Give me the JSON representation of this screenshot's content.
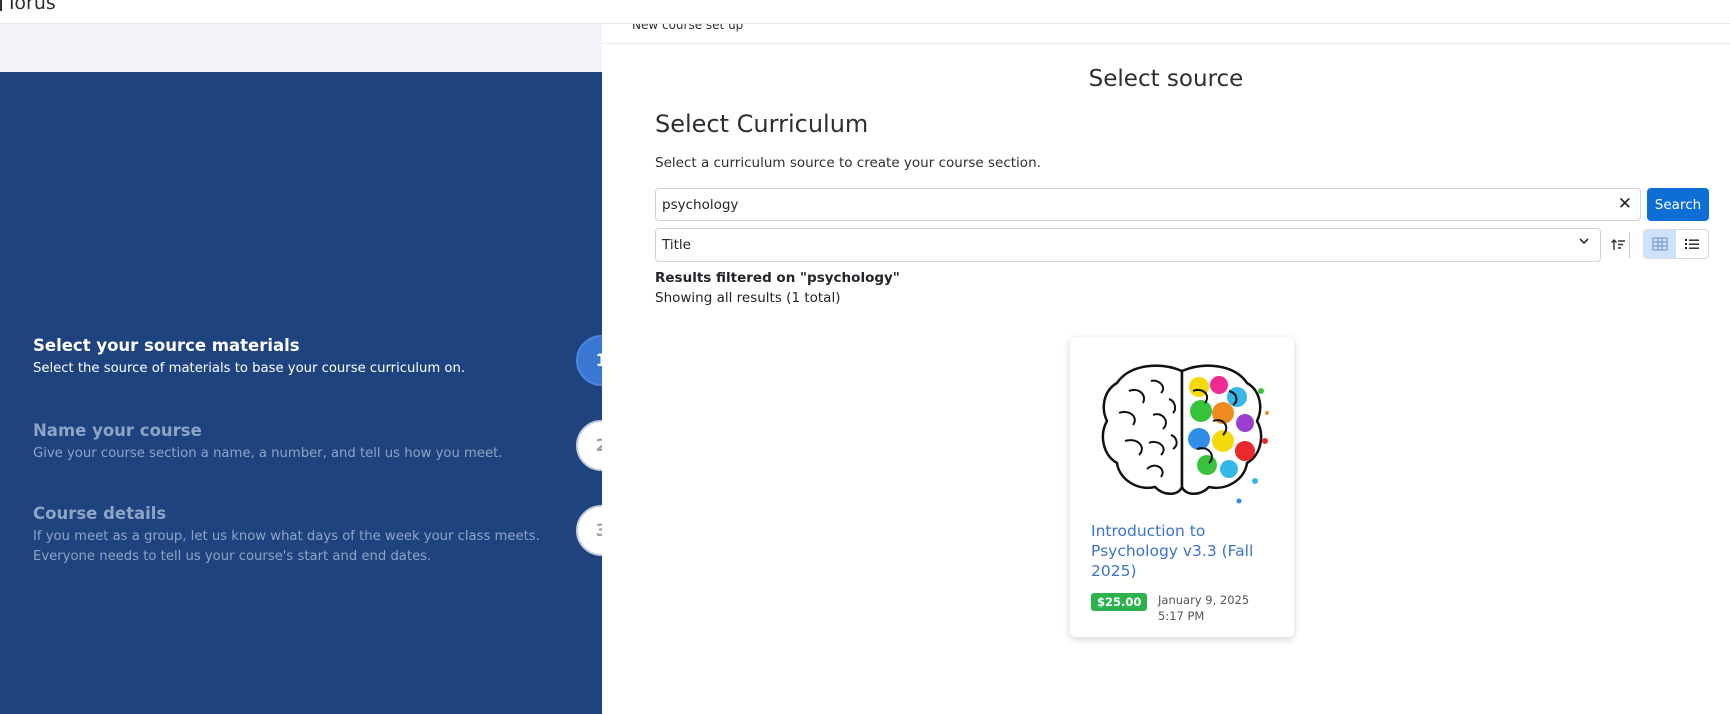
{
  "app": {
    "brand": "Torus"
  },
  "breadcrumb": "New course set up",
  "steps": [
    {
      "number": "1",
      "title": "Select your source materials",
      "desc": "Select the source of materials to base your course curriculum on.",
      "state": "active"
    },
    {
      "number": "2",
      "title": "Name your course",
      "desc": "Give your course section a name, a number, and tell us how you meet.",
      "state": "inactive"
    },
    {
      "number": "3",
      "title": "Course details",
      "desc_line1": "If you meet as a group, let us know what days of the week your class meets.",
      "desc_line2": "Everyone needs to tell us your course's start and end dates.",
      "state": "inactive"
    }
  ],
  "main": {
    "heading": "Select source",
    "section_title": "Select Curriculum",
    "section_desc": "Select a curriculum source to create your course section.",
    "search": {
      "value": "psychology",
      "clear_label": "✕",
      "button_label": "Search"
    },
    "sort": {
      "selected": "Title"
    },
    "filter_text": "Results filtered on \"psychology\"",
    "total_text": "Showing all results (1 total)"
  },
  "results": [
    {
      "title": "Introduction to Psychology v3.3 (Fall 2025)",
      "price": "$25.00",
      "date": "January 9, 2025 5:17 PM",
      "image": "brain-illustration"
    }
  ],
  "colors": {
    "sidebar": "#1e437f",
    "active_step": "#3b78d3",
    "primary_button": "#0d6ed6",
    "price_badge": "#2bb24c",
    "link": "#3a73c8"
  },
  "icons": {
    "clear": "close-icon",
    "sort_direction": "sort-ascending-icon",
    "card_view": "grid-icon",
    "list_view": "list-icon",
    "dropdown": "chevron-down-icon"
  }
}
